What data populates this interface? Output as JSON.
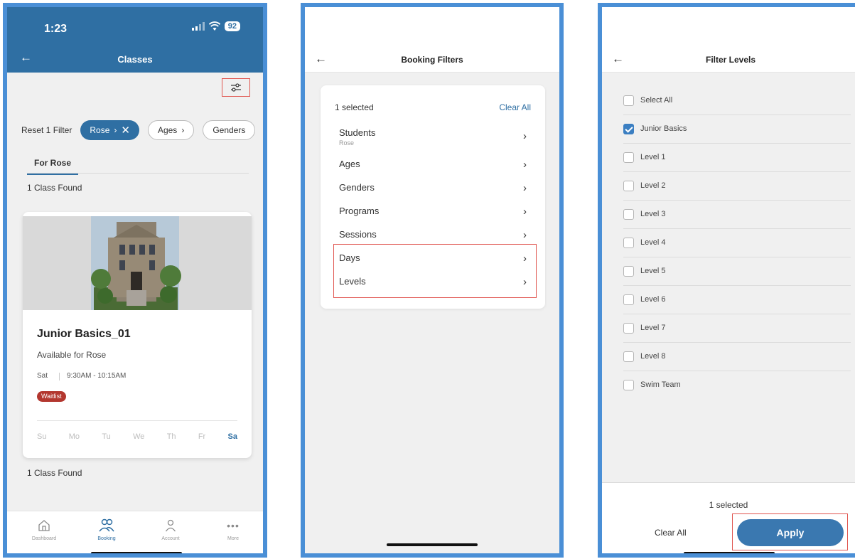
{
  "classes_screen": {
    "status_time": "1:23",
    "battery": "92",
    "title": "Classes",
    "reset_label": "Reset 1 Filter",
    "chips": [
      {
        "label": "Rose"
      },
      {
        "label": "Ages"
      },
      {
        "label": "Genders"
      }
    ],
    "tab_label": "For Rose",
    "found_top": "1 Class Found",
    "card": {
      "title": "Junior Basics_01",
      "available": "Available for Rose",
      "day": "Sat",
      "time": "9:30AM - 10:15AM",
      "badge": "Waitlist",
      "weekdays": [
        "Su",
        "Mo",
        "Tu",
        "We",
        "Th",
        "Fr",
        "Sa"
      ],
      "selected_day": "Sa"
    },
    "found_bottom": "1 Class Found",
    "nav": [
      {
        "label": "Dashboard",
        "icon": "home-icon"
      },
      {
        "label": "Booking",
        "icon": "people-icon"
      },
      {
        "label": "Account",
        "icon": "person-icon"
      },
      {
        "label": "More",
        "icon": "more-icon"
      }
    ],
    "colors": {
      "primary": "#2f6fa3",
      "highlight": "#e0554f",
      "waitlist": "#b3372f"
    }
  },
  "booking_filters": {
    "title": "Booking Filters",
    "selected_count": "1 selected",
    "clear_all": "Clear All",
    "rows": [
      {
        "label": "Students",
        "sub": "Rose"
      },
      {
        "label": "Ages"
      },
      {
        "label": "Genders"
      },
      {
        "label": "Programs"
      },
      {
        "label": "Sessions"
      },
      {
        "label": "Days"
      },
      {
        "label": "Levels"
      }
    ]
  },
  "filter_levels": {
    "title": "Filter Levels",
    "items": [
      {
        "label": "Select All",
        "checked": false
      },
      {
        "label": "Junior Basics",
        "checked": true
      },
      {
        "label": "Level 1",
        "checked": false
      },
      {
        "label": "Level 2",
        "checked": false
      },
      {
        "label": "Level 3",
        "checked": false
      },
      {
        "label": "Level 4",
        "checked": false
      },
      {
        "label": "Level 5",
        "checked": false
      },
      {
        "label": "Level 6",
        "checked": false
      },
      {
        "label": "Level 7",
        "checked": false
      },
      {
        "label": "Level 8",
        "checked": false
      },
      {
        "label": "Swim Team",
        "checked": false
      }
    ],
    "selected_count": "1 selected",
    "clear_all": "Clear All",
    "apply": "Apply"
  }
}
